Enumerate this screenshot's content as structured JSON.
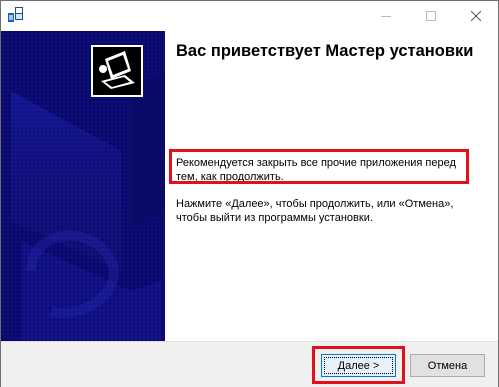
{
  "window": {
    "title": "",
    "caption_buttons": {
      "minimize_icon": "minimize-icon",
      "maximize_icon": "maximize-icon",
      "close_icon": "close-icon"
    }
  },
  "wizard": {
    "title": "Вас приветствует Мастер установки",
    "paragraph1": "Рекомендуется закрыть все прочие приложения перед тем, как продолжить.",
    "paragraph2": "Нажмите «Далее», чтобы продолжить, или «Отмена», чтобы выйти из программы установки."
  },
  "buttons": {
    "next": "Далее >",
    "cancel": "Отмена"
  },
  "colors": {
    "banner_dark": "#0a0a6e",
    "highlight": "#e0111b",
    "footer": "#f0f0f0"
  }
}
